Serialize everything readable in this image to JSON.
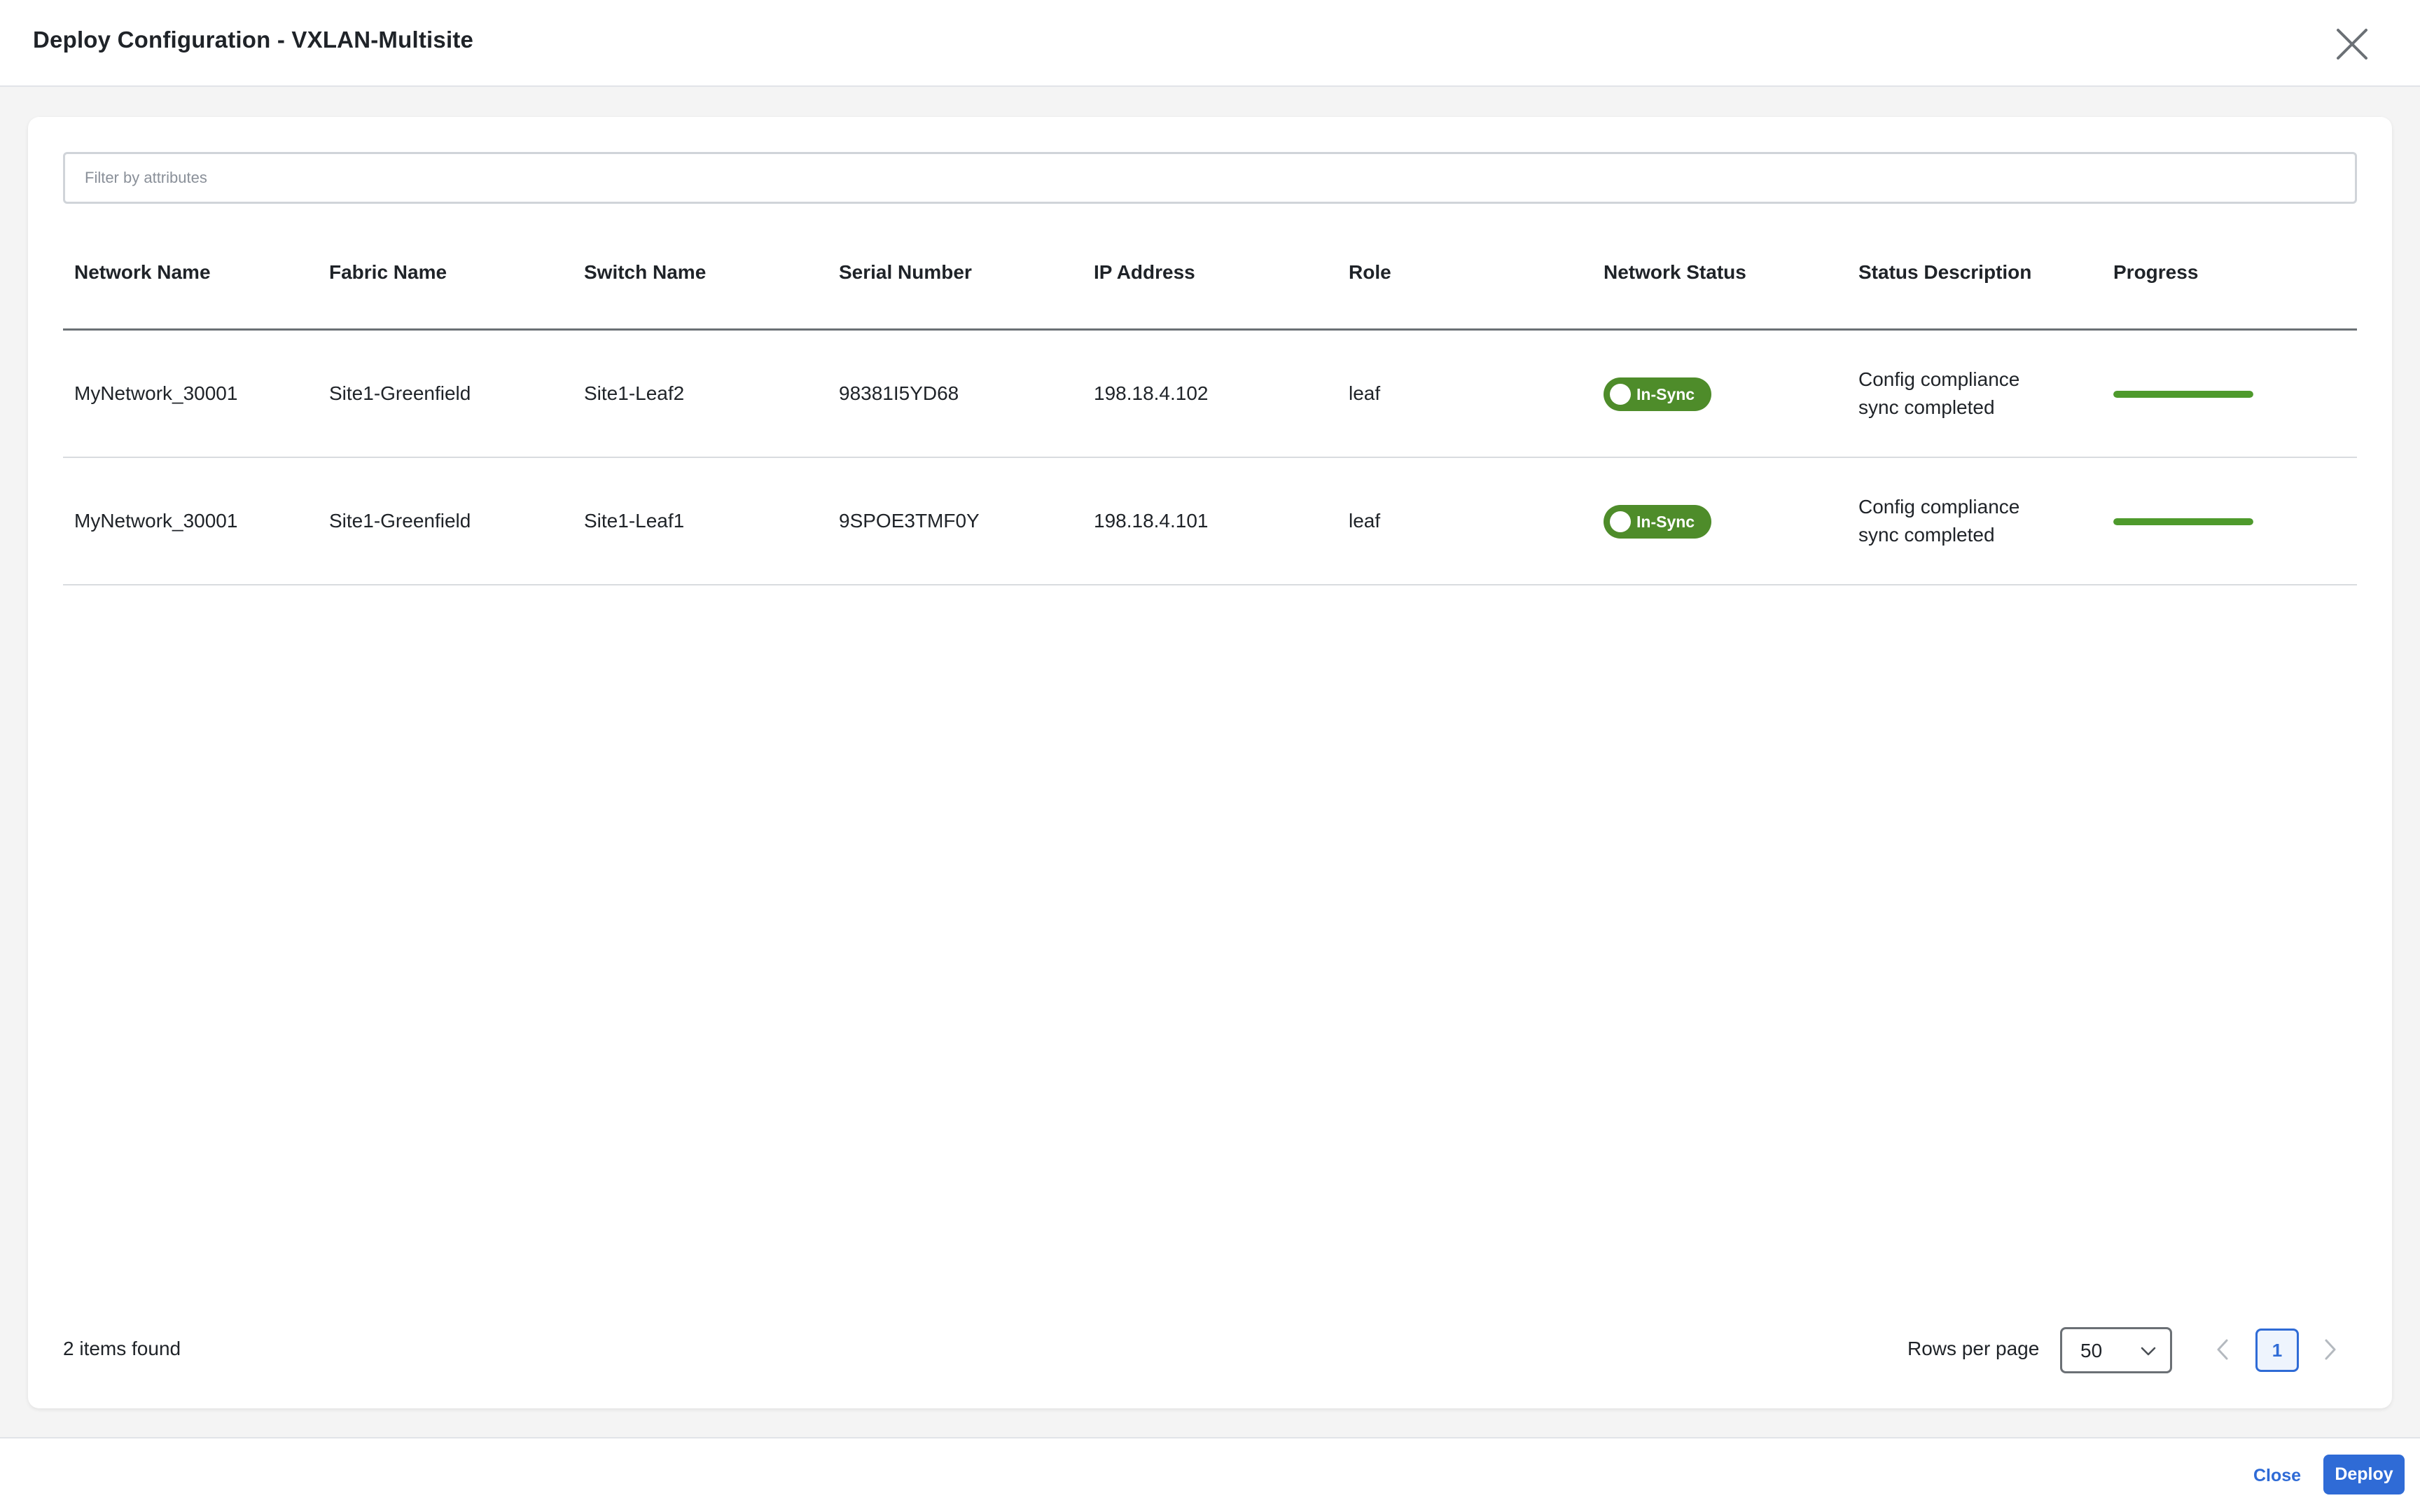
{
  "header": {
    "title": "Deploy Configuration - VXLAN-Multisite"
  },
  "filter": {
    "placeholder": "Filter by attributes"
  },
  "table": {
    "columns": [
      "Network Name",
      "Fabric Name",
      "Switch Name",
      "Serial Number",
      "IP Address",
      "Role",
      "Network Status",
      "Status Description",
      "Progress"
    ],
    "rows": [
      {
        "network_name": "MyNetwork_30001",
        "fabric_name": "Site1-Greenfield",
        "switch_name": "Site1-Leaf2",
        "serial_number": "98381I5YD68",
        "ip_address": "198.18.4.102",
        "role": "leaf",
        "status": "In-Sync",
        "desc_line1": "Config compliance",
        "desc_line2": "sync completed",
        "progress": 1.0
      },
      {
        "network_name": "MyNetwork_30001",
        "fabric_name": "Site1-Greenfield",
        "switch_name": "Site1-Leaf1",
        "serial_number": "9SPOE3TMF0Y",
        "ip_address": "198.18.4.101",
        "role": "leaf",
        "status": "In-Sync",
        "desc_line1": "Config compliance",
        "desc_line2": "sync completed",
        "progress": 1.0
      }
    ]
  },
  "footer": {
    "count": "2 items found",
    "rows_per_page_label": "Rows per page",
    "rows_per_page_value": "50",
    "current_page": "1"
  },
  "actions": {
    "close": "Close",
    "deploy": "Deploy"
  },
  "colors": {
    "accent": "#2f6bd6",
    "status_green": "#4e8c2a"
  },
  "icons": {
    "close": "close-icon",
    "select": "chevron-down-icon",
    "prev": "chevron-left-icon",
    "next": "chevron-right-icon",
    "status": "status-dot-icon"
  }
}
